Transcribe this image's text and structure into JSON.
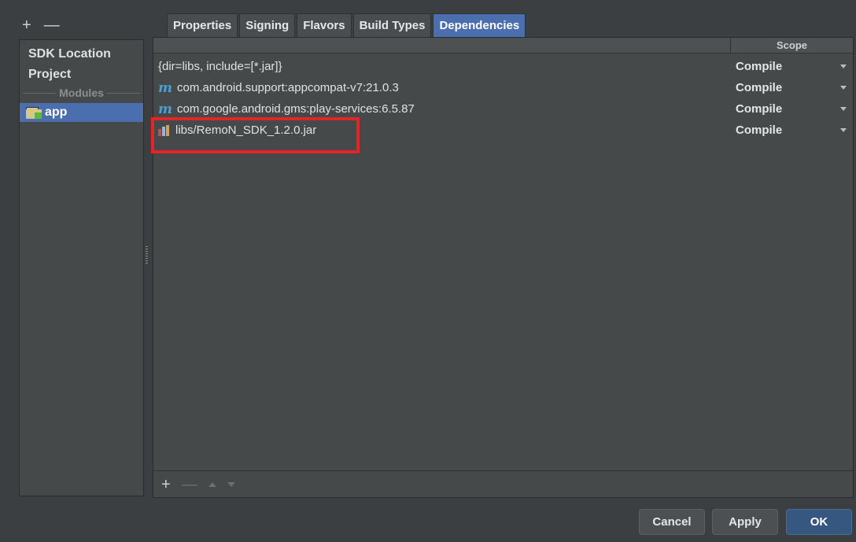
{
  "toolbar": {
    "add_label": "+",
    "remove_label": "—"
  },
  "sidebar": {
    "items": [
      {
        "label": "SDK Location"
      },
      {
        "label": "Project"
      }
    ],
    "section_label": "Modules",
    "modules": [
      {
        "label": "app",
        "icon": "module-folder-icon",
        "selected": true
      }
    ]
  },
  "tabs": [
    {
      "label": "Properties"
    },
    {
      "label": "Signing"
    },
    {
      "label": "Flavors"
    },
    {
      "label": "Build Types"
    },
    {
      "label": "Dependencies",
      "active": true
    }
  ],
  "dependencies": {
    "column_scope": "Scope",
    "rows": [
      {
        "icon": "none",
        "name": "{dir=libs, include=[*.jar]}",
        "scope": "Compile"
      },
      {
        "icon": "maven-icon",
        "icon_glyph": "m",
        "name": "com.android.support:appcompat-v7:21.0.3",
        "scope": "Compile"
      },
      {
        "icon": "maven-icon",
        "icon_glyph": "m",
        "name": "com.google.android.gms:play-services:6.5.87",
        "scope": "Compile"
      },
      {
        "icon": "jar-icon",
        "name": "libs/RemoN_SDK_1.2.0.jar",
        "scope": "Compile",
        "highlighted": true
      }
    ],
    "bottom_tools": {
      "add_label": "+",
      "remove_label": "—"
    }
  },
  "footer": {
    "cancel": "Cancel",
    "apply": "Apply",
    "ok": "OK"
  },
  "colors": {
    "accent": "#4b6eaf",
    "highlight": "#e52427",
    "maven": "#4b9fd5",
    "primary_button": "#365880"
  }
}
